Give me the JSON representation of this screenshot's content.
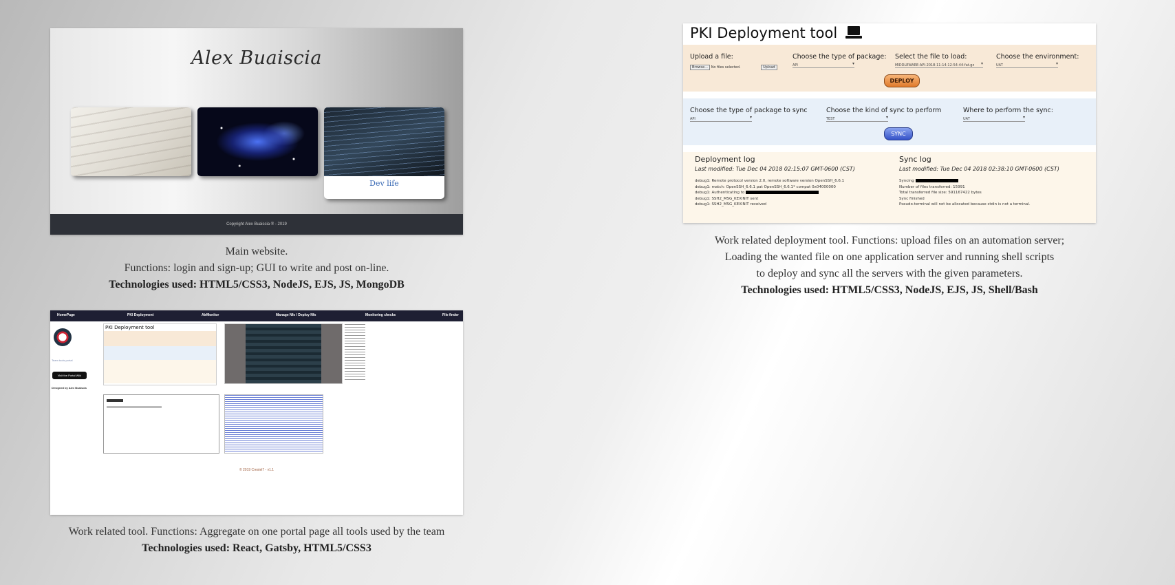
{
  "project1": {
    "site": {
      "signature": "Alex Buaiscia",
      "cards": [
        {
          "name": "writing",
          "label": ""
        },
        {
          "name": "space",
          "label": ""
        },
        {
          "name": "dev",
          "label": "Dev life"
        }
      ],
      "footer": "Copyright Alex Buaiscia ® - 2019"
    },
    "caption": {
      "line1": "Main website.",
      "line2": "Functions: login and sign-up; GUI to write and post on-line.",
      "tech": "Technologies used: HTML5/CSS3, NodeJS, EJS, JS, MongoDB"
    }
  },
  "project2": {
    "site": {
      "title": "PKI Deployment tool",
      "upload_label": "Upload a file:",
      "browse_label": "Browse...",
      "no_file": "No files selected.",
      "upload_button": "Upload",
      "package_label": "Choose the type of package:",
      "package_value": "API",
      "file_label": "Select the file to load:",
      "file_value": "MIDDLEWARE-API-2018-11-14-12-54-44-fat.gz",
      "env_label": "Choose the environment:",
      "env_value": "UAT",
      "deploy_button": "DEPLOY",
      "sync_package_label": "Choose the type of package to sync",
      "sync_package_value": "API",
      "sync_kind_label": "Choose the kind of sync to perform",
      "sync_kind_value": "TEST",
      "sync_where_label": "Where to perform the sync:",
      "sync_where_value": "UAT",
      "sync_button": "SYNC",
      "deploy_log": {
        "title": "Deployment log",
        "modified": "Last modified: Tue Dec 04 2018 02:15:07 GMT-0600 (CST)",
        "lines": [
          "debug1: Remote protocol version 2.0, remote software version OpenSSH_6.6.1",
          "debug1: match: OpenSSH_6.6.1 pat OpenSSH_6.6.1* compat 0x04000000",
          "debug1: Authenticating to",
          "debug1: SSH2_MSG_KEXINIT sent",
          "debug1: SSH2_MSG_KEXINIT received"
        ]
      },
      "sync_log": {
        "title": "Sync log",
        "modified": "Last modified: Tue Dec 04 2018 02:38:10 GMT-0600 (CST)",
        "lines": [
          "Syncing",
          "Number of files transferred: 15991",
          "Total transferred file size: 591167422 bytes",
          "Sync finished",
          "Pseudo-terminal will not be allocated because stdin is not a terminal."
        ]
      }
    },
    "caption": {
      "line1": "Work related deployment tool. Functions: upload files on an automation server;",
      "line2": "Loading the wanted file on one application server and running shell scripts",
      "line3": "to deploy and sync all the servers with the given parameters.",
      "tech": "Technologies used: HTML5/CSS3, NodeJS, EJS, JS, Shell/Bash"
    }
  },
  "project3": {
    "site": {
      "nav": [
        "HomePage",
        "PKI Deployment",
        "AirMonitor",
        "Manage Nfs / Deploy Nfs",
        "Monitoring checks",
        "File finder"
      ],
      "side_text": "Team tools portal",
      "side_button": "Visit the Portal Wiki",
      "designed_by": "Designed by Alex Buaiscia",
      "inner_title": "PKI Deployment tool",
      "footer": "© 2019 Crestel7 - v1.1"
    },
    "caption": {
      "line1": "Work related tool. Functions: Aggregate on one portal page all tools used by the team",
      "tech": "Technologies used: React, Gatsby, HTML5/CSS3"
    }
  }
}
